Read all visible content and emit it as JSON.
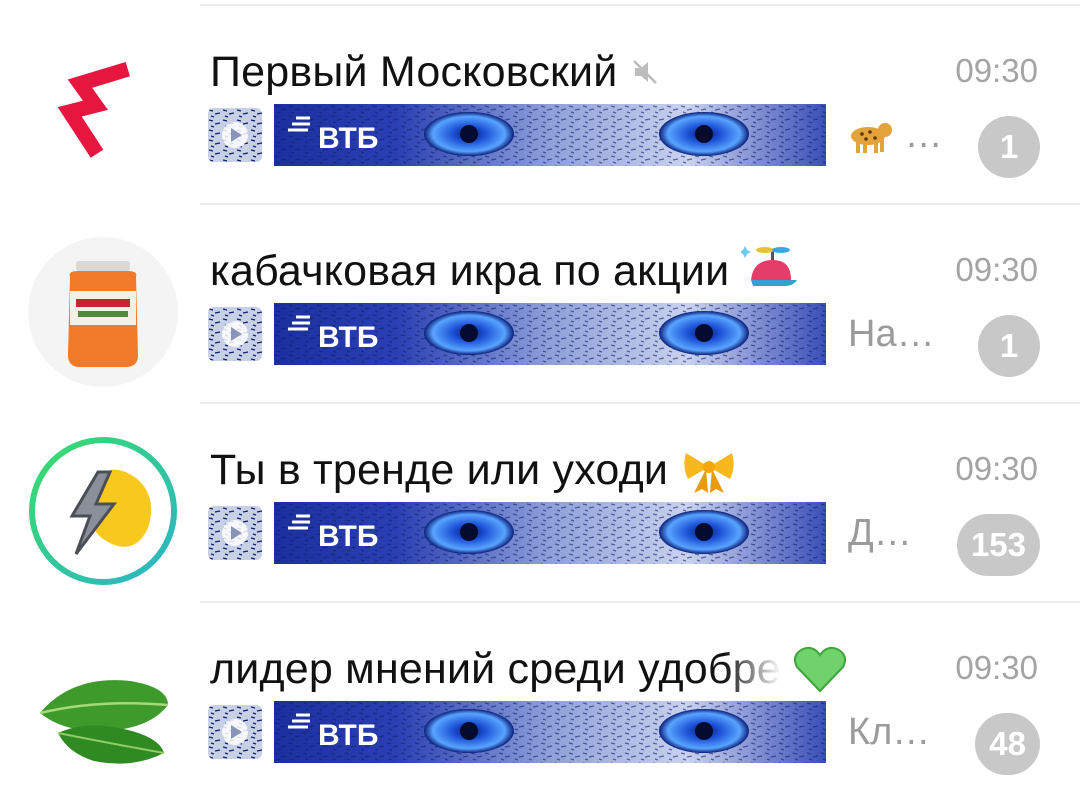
{
  "chats": [
    {
      "avatar": "moscow-logo-avatar",
      "title": "Первый Московский",
      "title_icon": "muted-speaker-icon",
      "time": "09:30",
      "media": {
        "thumb": "video-play-icon",
        "banner_text": "ВТБ"
      },
      "snippet_icon": "leopard-emoji-icon",
      "snippet": "…",
      "unread": "1"
    },
    {
      "avatar": "zucchini-caviar-jar-avatar",
      "title": "кабачковая икра по акции",
      "title_icon": "propeller-cap-emoji-icon",
      "time": "09:30",
      "media": {
        "thumb": "video-play-icon",
        "banner_text": "ВТБ"
      },
      "snippet": "На…",
      "unread": "1"
    },
    {
      "avatar": "lightning-blob-avatar",
      "title": "Ты в тренде или уходи",
      "title_icon": "ribbon-bow-emoji-icon",
      "time": "09:30",
      "media": {
        "thumb": "video-play-icon",
        "banner_text": "ВТБ"
      },
      "snippet": "Д…",
      "unread": "153"
    },
    {
      "avatar": "green-leaf-avatar",
      "title": "лидер мнений среди удобре",
      "title_icon": "green-heart-emoji-icon",
      "time": "09:30",
      "media": {
        "thumb": "video-play-icon",
        "banner_text": "ВТБ"
      },
      "snippet": "Кл…",
      "unread": "48"
    }
  ],
  "colors": {
    "badge": "#c8c8c8",
    "time": "#a4a4a4",
    "snippet": "#9b9b9b",
    "brand_red": "#e5173f",
    "vtb_blue": "#1b2f9e"
  }
}
